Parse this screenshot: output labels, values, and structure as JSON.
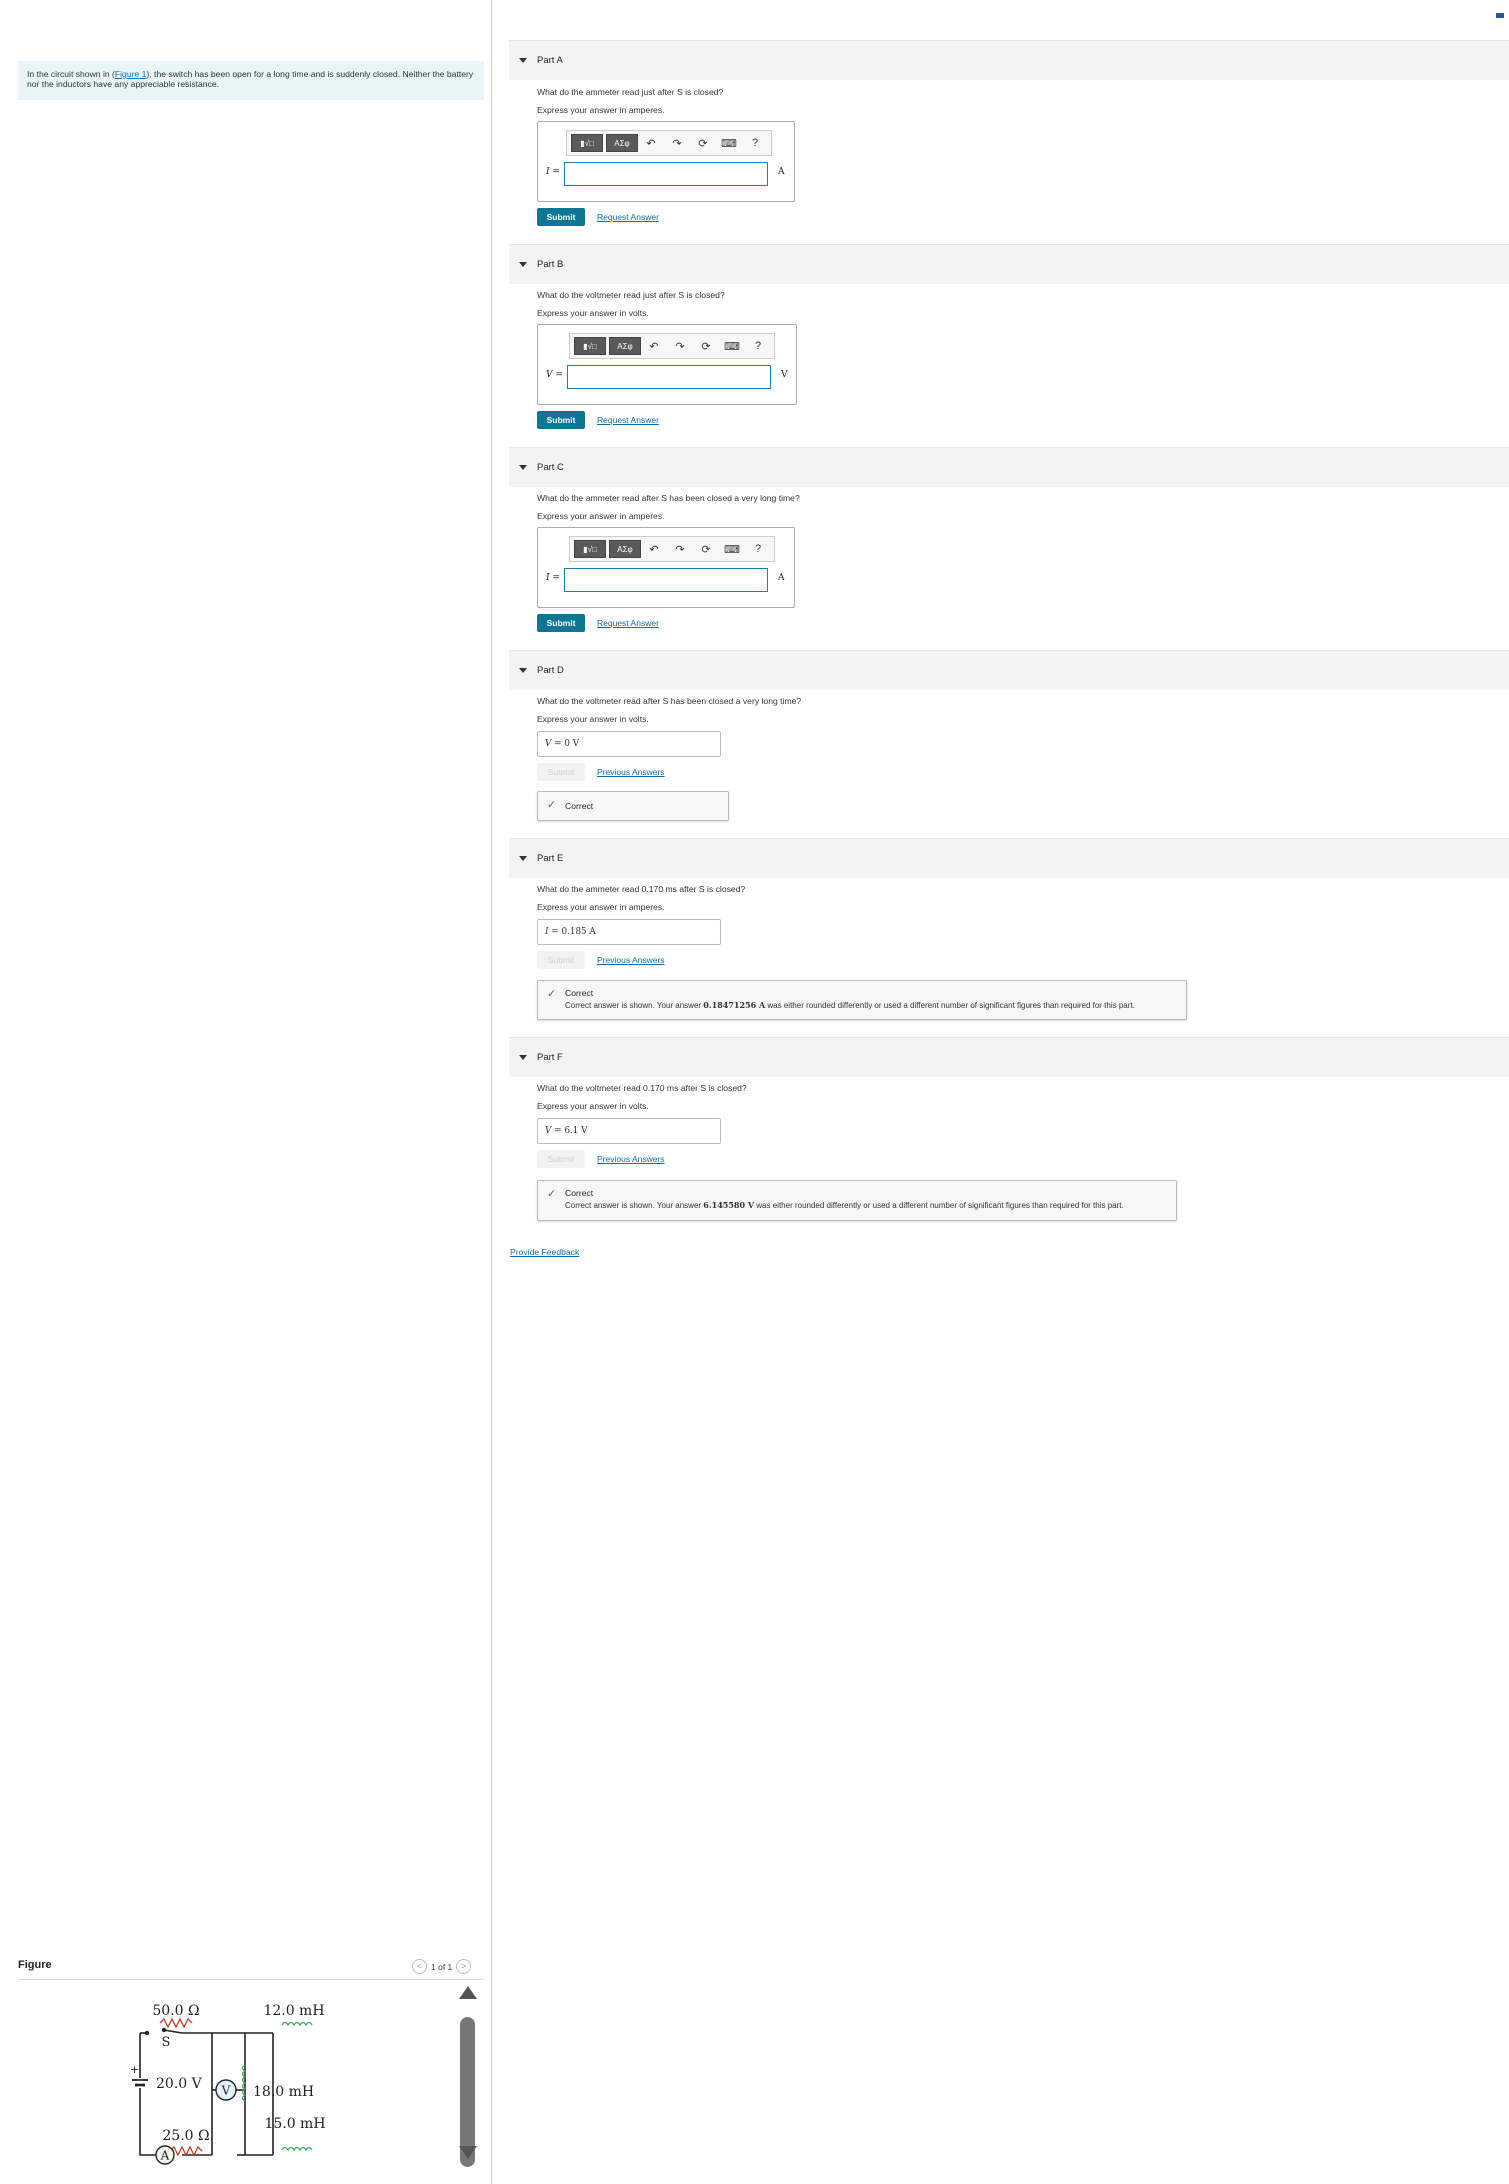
{
  "intro": {
    "text_before": "In the circuit shown in (",
    "figure_link": "Figure 1",
    "text_after": "), the switch has been open for a long time and is suddenly closed. Neither the battery nor the inductors have any appreciable resistance."
  },
  "figure": {
    "label": "Figure",
    "pager": "1 of 1",
    "prev": "<",
    "next": ">",
    "circuit": {
      "switch": "S",
      "battery": "20.0 V",
      "battery_plus": "+",
      "r1": "50.0 Ω",
      "r2": "25.0 Ω",
      "l1": "12.0 mH",
      "l2": "18.0 mH",
      "l3": "15.0 mH",
      "voltmeter": "V",
      "ammeter": "A"
    }
  },
  "toolbar": {
    "template": "▮√□",
    "greek": "ΑΣφ",
    "undo": "↶",
    "redo": "↷",
    "reset": "⟳",
    "keyboard": "⌨",
    "help": "?"
  },
  "parts": {
    "a": {
      "title": "Part A",
      "question": "What do the ammeter read just after S is closed?",
      "express": "Express your answer in amperes.",
      "var": "I =",
      "unit": "A",
      "submit": "Submit",
      "link": "Request Answer"
    },
    "b": {
      "title": "Part B",
      "question": "What do the voltmeter read just after S is closed?",
      "express": "Express your answer in volts.",
      "var": "V =",
      "unit": "V",
      "submit": "Submit",
      "link": "Request Answer"
    },
    "c": {
      "title": "Part C",
      "question": "What do the ammeter read after S has been closed a very long time?",
      "express": "Express your answer in amperes.",
      "var": "I =",
      "unit": "A",
      "submit": "Submit",
      "link": "Request Answer"
    },
    "d": {
      "title": "Part D",
      "question": "What do the voltmeter read after S has been closed a very long time?",
      "express": "Express your answer in volts.",
      "var": "V",
      "answer": "= 0  V",
      "submit": "Submit",
      "link": "Previous Answers",
      "fb_title": "Correct"
    },
    "e": {
      "title": "Part E",
      "question": "What do the ammeter read 0.170 ms after S is closed?",
      "express": "Express your answer in amperes.",
      "var": "I",
      "answer": "= 0.185  A",
      "submit": "Submit",
      "link": "Previous Answers",
      "fb_title": "Correct",
      "fb_before": "Correct answer is shown. Your answer ",
      "fb_value": "0.18471256 A",
      "fb_after": " was either rounded differently or used a different number of significant figures than required for this part."
    },
    "f": {
      "title": "Part F",
      "question": "What do the voltmeter read 0.170 ms after S is closed?",
      "express": "Express your answer in volts.",
      "var": "V",
      "answer": "= 6.1  V",
      "submit": "Submit",
      "link": "Previous Answers",
      "fb_title": "Correct",
      "fb_before": "Correct answer is shown. Your answer ",
      "fb_value": "6.145580 V",
      "fb_after": " was either rounded differently or used a different number of significant figures than required for this part."
    }
  },
  "provide_feedback": "Provide Feedback",
  "colors": {
    "accent": "#0f7595",
    "link": "#0c6ca8",
    "intro_bg": "#e8f4f6",
    "correct": "#2e7d32",
    "inductor": "#3aa655"
  }
}
